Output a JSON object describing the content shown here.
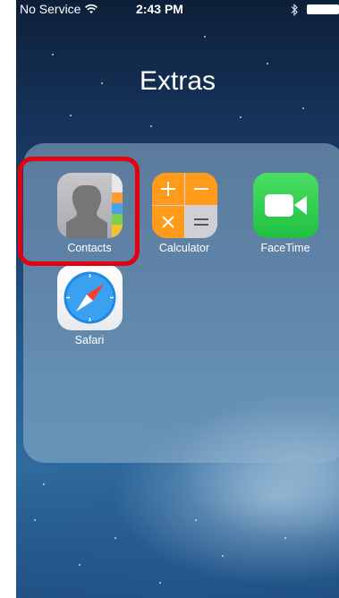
{
  "status_bar": {
    "carrier": "No Service",
    "time": "2:43 PM",
    "wifi_icon": "wifi-icon",
    "bluetooth_icon": "bluetooth-icon",
    "battery_icon": "battery-icon"
  },
  "folder": {
    "title": "Extras",
    "apps": [
      {
        "label": "Contacts",
        "icon": "contacts-icon",
        "highlighted": true
      },
      {
        "label": "Calculator",
        "icon": "calculator-icon"
      },
      {
        "label": "FaceTime",
        "icon": "facetime-icon"
      },
      {
        "label": "Safari",
        "icon": "safari-icon"
      }
    ]
  },
  "highlight": {
    "color": "#e4000f"
  }
}
